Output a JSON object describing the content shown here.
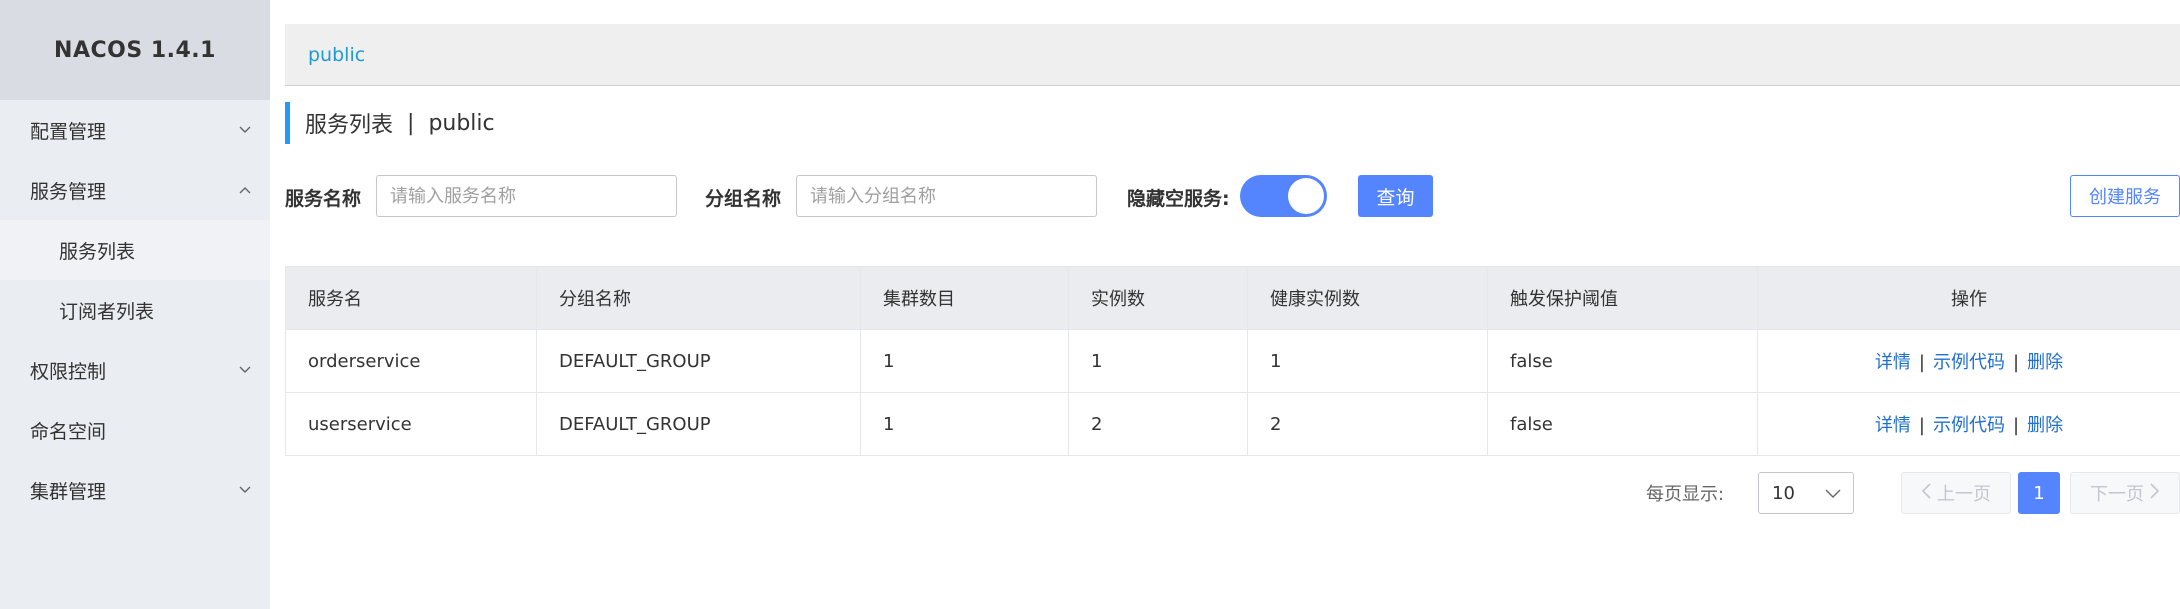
{
  "brand": {
    "title": "NACOS 1.4.1"
  },
  "sidebar": {
    "items": [
      {
        "label": "配置管理",
        "expanded": false
      },
      {
        "label": "服务管理",
        "expanded": true,
        "children": [
          {
            "label": "服务列表",
            "active": true
          },
          {
            "label": "订阅者列表",
            "active": false
          }
        ]
      },
      {
        "label": "权限控制",
        "expanded": false
      },
      {
        "label": "命名空间"
      },
      {
        "label": "集群管理",
        "expanded": false
      }
    ]
  },
  "namespace_bar": {
    "current": "public"
  },
  "page_title": {
    "title": "服务列表",
    "separator": "|",
    "namespace": "public"
  },
  "filters": {
    "service_name_label": "服务名称",
    "service_name_placeholder": "请输入服务名称",
    "group_name_label": "分组名称",
    "group_name_placeholder": "请输入分组名称",
    "hide_empty_label": "隐藏空服务:",
    "hide_empty_on": true,
    "query_button": "查询",
    "create_button": "创建服务"
  },
  "table": {
    "columns": [
      "服务名",
      "分组名称",
      "集群数目",
      "实例数",
      "健康实例数",
      "触发保护阈值",
      "操作"
    ],
    "rows": [
      {
        "service": "orderservice",
        "group": "DEFAULT_GROUP",
        "clusters": "1",
        "instances": "1",
        "healthy": "1",
        "protect": "false"
      },
      {
        "service": "userservice",
        "group": "DEFAULT_GROUP",
        "clusters": "1",
        "instances": "2",
        "healthy": "2",
        "protect": "false"
      }
    ],
    "actions": {
      "detail": "详情",
      "sample": "示例代码",
      "delete": "删除",
      "separator": "|"
    }
  },
  "pagination": {
    "page_size_label": "每页显示:",
    "page_size": "10",
    "prev": "上一页",
    "current_page": "1",
    "next": "下一页"
  },
  "colors": {
    "primary": "#5584ff",
    "link": "#1f9bd1",
    "sidebar_bg": "#eaedf1"
  }
}
